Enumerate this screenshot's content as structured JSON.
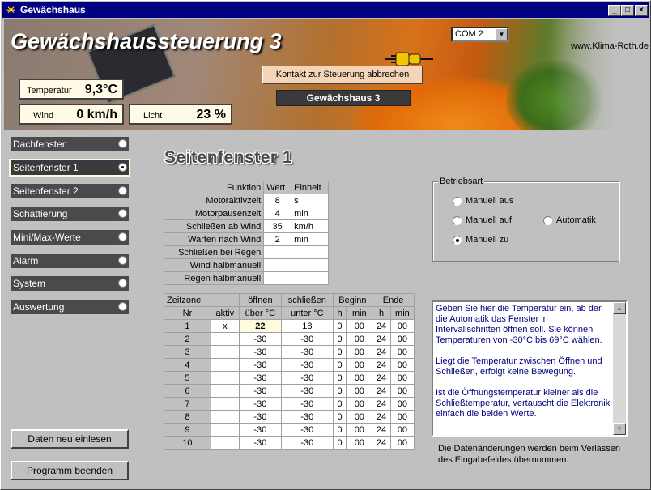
{
  "window": {
    "title": "Gewächshaus",
    "min_label": "_",
    "max_label": "□",
    "close_label": "×"
  },
  "banner": {
    "app_title": "Gewächshaussteuerung 3",
    "website": "www.Klima-Roth.de",
    "port": {
      "selected": "COM 2"
    },
    "readouts": {
      "temperatur": {
        "label": "Temperatur",
        "value": "9,3°C"
      },
      "wind": {
        "label": "Wind",
        "value": "0 km/h"
      },
      "licht": {
        "label": "Licht",
        "value": "23 %"
      }
    },
    "contact_button": "Kontakt zur Steuerung abbrechen",
    "greenhouse_name": "Gewächshaus 3"
  },
  "nav": {
    "items": [
      {
        "label": "Dachfenster",
        "active": false
      },
      {
        "label": "Seitenfenster 1",
        "active": true
      },
      {
        "label": "Seitenfenster 2",
        "active": false
      },
      {
        "label": "Schattierung",
        "active": false
      },
      {
        "label": "Mini/Max-Werte",
        "active": false
      },
      {
        "label": "Alarm",
        "active": false
      },
      {
        "label": "System",
        "active": false
      },
      {
        "label": "Auswertung",
        "active": false
      }
    ],
    "reload_button": "Daten neu einlesen",
    "exit_button": "Programm beenden"
  },
  "page": {
    "heading": "Seitenfenster 1"
  },
  "function_table": {
    "headers": [
      "Funktion",
      "Wert",
      "Einheit"
    ],
    "rows": [
      [
        "Motoraktivzeit",
        "8",
        "s"
      ],
      [
        "Motorpausenzeit",
        "4",
        "min"
      ],
      [
        "Schließen ab Wind",
        "35",
        "km/h"
      ],
      [
        "Warten nach Wind",
        "2",
        "min"
      ],
      [
        "Schließen bei Regen",
        "",
        ""
      ],
      [
        "Wind halbmanuell",
        "",
        ""
      ],
      [
        "Regen halbmanuell",
        "",
        ""
      ]
    ]
  },
  "zone_table": {
    "header1": [
      "Zeitzone",
      "",
      "öffnen",
      "schließen",
      "Beginn",
      "Ende"
    ],
    "header2": [
      "Nr",
      "aktiv",
      "über °C",
      "unter °C",
      "h",
      "min",
      "h",
      "min"
    ],
    "rows": [
      [
        "1",
        "x",
        "22",
        "18",
        "0",
        "00",
        "24",
        "00"
      ],
      [
        "2",
        "",
        "-30",
        "-30",
        "0",
        "00",
        "24",
        "00"
      ],
      [
        "3",
        "",
        "-30",
        "-30",
        "0",
        "00",
        "24",
        "00"
      ],
      [
        "4",
        "",
        "-30",
        "-30",
        "0",
        "00",
        "24",
        "00"
      ],
      [
        "5",
        "",
        "-30",
        "-30",
        "0",
        "00",
        "24",
        "00"
      ],
      [
        "6",
        "",
        "-30",
        "-30",
        "0",
        "00",
        "24",
        "00"
      ],
      [
        "7",
        "",
        "-30",
        "-30",
        "0",
        "00",
        "24",
        "00"
      ],
      [
        "8",
        "",
        "-30",
        "-30",
        "0",
        "00",
        "24",
        "00"
      ],
      [
        "9",
        "",
        "-30",
        "-30",
        "0",
        "00",
        "24",
        "00"
      ],
      [
        "10",
        "",
        "-30",
        "-30",
        "0",
        "00",
        "24",
        "00"
      ]
    ]
  },
  "betriebsart": {
    "title": "Betriebsart",
    "options": [
      {
        "label": "Manuell aus",
        "selected": false
      },
      {
        "label": "Manuell auf",
        "selected": false
      },
      {
        "label": "Automatik",
        "selected": false
      },
      {
        "label": "Manuell zu",
        "selected": true
      }
    ]
  },
  "help": {
    "paragraphs": [
      "Geben Sie hier die Temperatur ein, ab der die Automatik das Fenster in Intervallschritten öffnen soll. Sie können Temperaturen von -30°C bis 69°C wählen.",
      "Liegt die Temperatur zwischen Öffnen und Schließen, erfolgt keine Bewegung.",
      "Ist die Öffnungstemperatur kleiner als die Schließtemperatur, vertauscht die Elektronik einfach die beiden Werte."
    ],
    "note": "Die Datenänderungen werden beim Verlassen des Eingabefeldes übernommen."
  }
}
